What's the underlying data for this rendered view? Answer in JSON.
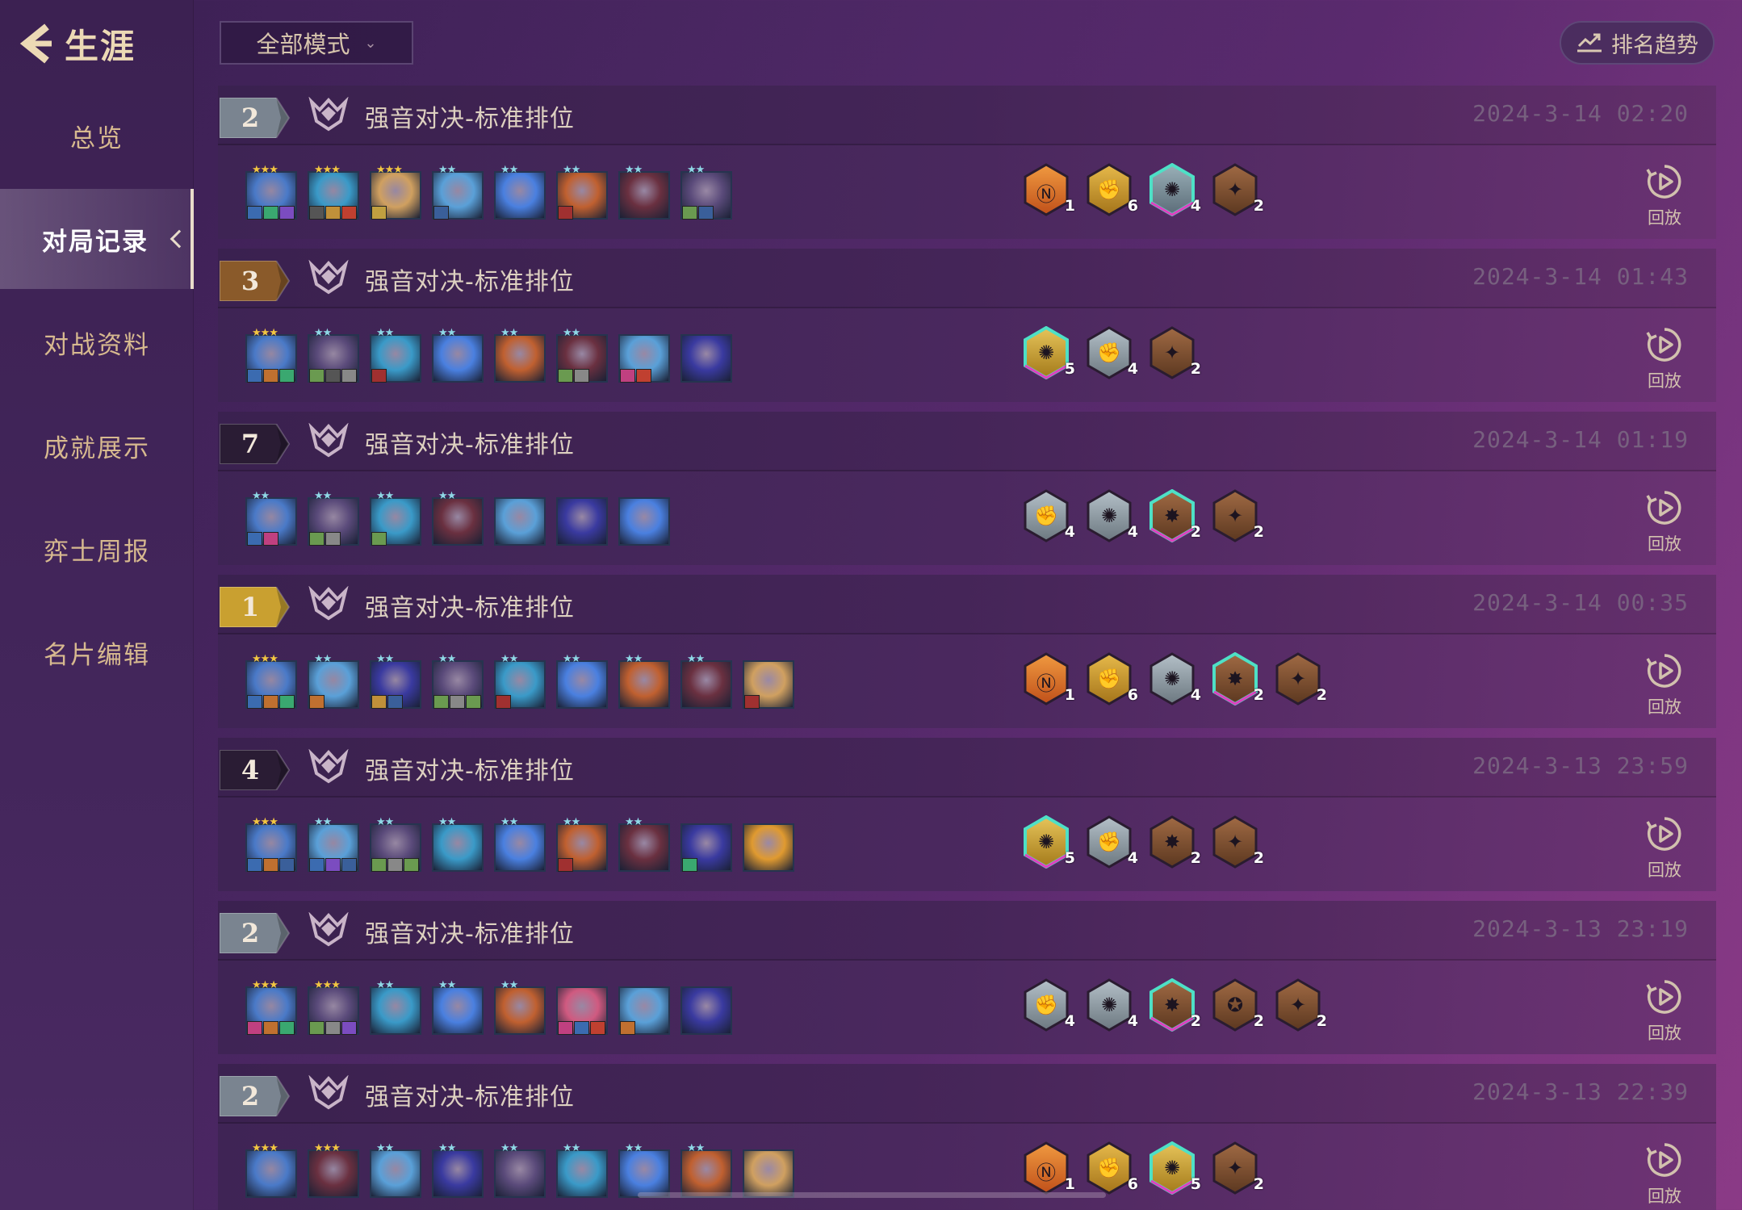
{
  "sidebar": {
    "back_icon": "chevron-left-icon",
    "title": "生涯",
    "items": [
      {
        "label": "总览",
        "active": false
      },
      {
        "label": "对局记录",
        "active": true
      },
      {
        "label": "对战资料",
        "active": false
      },
      {
        "label": "成就展示",
        "active": false
      },
      {
        "label": "弈士周报",
        "active": false
      },
      {
        "label": "名片编辑",
        "active": false
      }
    ]
  },
  "toolbar": {
    "mode_filter": "全部模式",
    "trend_label": "排名趋势",
    "trend_icon": "trend-chart-icon"
  },
  "colors": {
    "gold": "#d9a428",
    "silver": "#9aa7b2",
    "bronze": "#8a5a38",
    "prismatic": "#4ee0c6",
    "orange": "#e8792a"
  },
  "matches": [
    {
      "rank": "2",
      "rank_tier": "silver",
      "mode": "强音对决-标准排位",
      "time": "2024-3-14 02:20",
      "units": [
        {
          "stars": "★★★",
          "star_color": "gold",
          "tone": "#4a7ac8",
          "items": [
            "#3b6bb0",
            "#3aa870",
            "#7b4cc0"
          ]
        },
        {
          "stars": "★★★",
          "star_color": "gold",
          "tone": "#3a9ac8",
          "items": [
            "#555",
            "#c0903a",
            "#c04030"
          ]
        },
        {
          "stars": "★★★",
          "star_color": "gold",
          "tone": "#d0a060",
          "items": [
            "#c0a040"
          ]
        },
        {
          "stars": "★★",
          "star_color": "cyan",
          "tone": "#5aa0d8",
          "items": [
            "#3a5f9a"
          ]
        },
        {
          "stars": "★★",
          "star_color": "cyan",
          "tone": "#4a80e0",
          "items": []
        },
        {
          "stars": "★★",
          "star_color": "cyan",
          "tone": "#c06030",
          "items": [
            "#a03030"
          ]
        },
        {
          "stars": "★★",
          "star_color": "cyan",
          "tone": "#6a3040",
          "items": []
        },
        {
          "stars": "★★",
          "star_color": "cyan",
          "tone": "#5a4a7a",
          "items": [
            "#6a9a50",
            "#3a5f9a"
          ]
        }
      ],
      "traits": [
        {
          "icon": "headliner-icon",
          "tier": "orange",
          "glyph": "Ⓝ",
          "count": "1"
        },
        {
          "icon": "punk-fist-icon",
          "tier": "gold",
          "glyph": "✊",
          "count": "6"
        },
        {
          "icon": "edm-star-icon",
          "tier": "prismatic",
          "glyph": "✺",
          "count": "4"
        },
        {
          "icon": "dazzler-icon",
          "tier": "bronze",
          "glyph": "✦",
          "count": "2"
        }
      ],
      "replay": "回放"
    },
    {
      "rank": "3",
      "rank_tier": "bronze",
      "mode": "强音对决-标准排位",
      "time": "2024-3-14 01:43",
      "units": [
        {
          "stars": "★★★",
          "star_color": "gold",
          "tone": "#4a7ac8",
          "items": [
            "#3b6bb0",
            "#c07030",
            "#3aa870"
          ]
        },
        {
          "stars": "★★",
          "star_color": "cyan",
          "tone": "#5a4a7a",
          "items": [
            "#6a9a50",
            "#555",
            "#888"
          ]
        },
        {
          "stars": "★★",
          "star_color": "cyan",
          "tone": "#3a9ac8",
          "items": [
            "#a03030"
          ]
        },
        {
          "stars": "★★",
          "star_color": "cyan",
          "tone": "#4a80e0",
          "items": []
        },
        {
          "stars": "★★",
          "star_color": "cyan",
          "tone": "#c06030",
          "items": []
        },
        {
          "stars": "★★",
          "star_color": "cyan",
          "tone": "#6a3040",
          "items": [
            "#6a9a50",
            "#888"
          ]
        },
        {
          "stars": "",
          "star_color": "none",
          "tone": "#5aa0d8",
          "items": [
            "#c04080",
            "#c04030"
          ]
        },
        {
          "stars": "",
          "star_color": "none",
          "tone": "#3a3aa0",
          "items": []
        }
      ],
      "traits": [
        {
          "icon": "edm-star-icon",
          "tier": "prismatic-gold",
          "glyph": "✺",
          "count": "5"
        },
        {
          "icon": "punk-fist-icon",
          "tier": "silver",
          "glyph": "✊",
          "count": "4"
        },
        {
          "icon": "dazzler-icon",
          "tier": "bronze",
          "glyph": "✦",
          "count": "2"
        }
      ],
      "replay": "回放"
    },
    {
      "rank": "7",
      "rank_tier": "dark",
      "mode": "强音对决-标准排位",
      "time": "2024-3-14 01:19",
      "units": [
        {
          "stars": "★★",
          "star_color": "cyan",
          "tone": "#4a7ac8",
          "items": [
            "#3b6bb0",
            "#c04080"
          ]
        },
        {
          "stars": "★★",
          "star_color": "cyan",
          "tone": "#5a4a7a",
          "items": [
            "#6a9a50",
            "#888"
          ]
        },
        {
          "stars": "★★",
          "star_color": "cyan",
          "tone": "#3a9ac8",
          "items": [
            "#6a9a50"
          ]
        },
        {
          "stars": "★★",
          "star_color": "cyan",
          "tone": "#6a3040",
          "items": []
        },
        {
          "stars": "",
          "star_color": "none",
          "tone": "#5aa0d8",
          "items": []
        },
        {
          "stars": "",
          "star_color": "none",
          "tone": "#3a3aa0",
          "items": []
        },
        {
          "stars": "",
          "star_color": "none",
          "tone": "#4a80e0",
          "items": []
        }
      ],
      "traits": [
        {
          "icon": "punk-fist-icon",
          "tier": "silver",
          "glyph": "✊",
          "count": "4"
        },
        {
          "icon": "edm-star-icon",
          "tier": "silver",
          "glyph": "✺",
          "count": "4"
        },
        {
          "icon": "burst-icon",
          "tier": "prismatic-bronze",
          "glyph": "✸",
          "count": "2"
        },
        {
          "icon": "dazzler-icon",
          "tier": "bronze",
          "glyph": "✦",
          "count": "2"
        }
      ],
      "replay": "回放"
    },
    {
      "rank": "1",
      "rank_tier": "gold",
      "mode": "强音对决-标准排位",
      "time": "2024-3-14 00:35",
      "units": [
        {
          "stars": "★★★",
          "star_color": "gold",
          "tone": "#4a7ac8",
          "items": [
            "#3b6bb0",
            "#c07030",
            "#3aa870"
          ]
        },
        {
          "stars": "★★",
          "star_color": "cyan",
          "tone": "#5aa0d8",
          "items": [
            "#c07030"
          ]
        },
        {
          "stars": "★★",
          "star_color": "cyan",
          "tone": "#3a3aa0",
          "items": [
            "#c0903a",
            "#3a5f9a"
          ]
        },
        {
          "stars": "★★",
          "star_color": "cyan",
          "tone": "#5a4a7a",
          "items": [
            "#6a9a50",
            "#888",
            "#6a9a50"
          ]
        },
        {
          "stars": "★★",
          "star_color": "cyan",
          "tone": "#3a9ac8",
          "items": [
            "#a03030"
          ]
        },
        {
          "stars": "★★",
          "star_color": "cyan",
          "tone": "#4a80e0",
          "items": []
        },
        {
          "stars": "★★",
          "star_color": "cyan",
          "tone": "#c06030",
          "items": []
        },
        {
          "stars": "★★",
          "star_color": "cyan",
          "tone": "#6a3040",
          "items": []
        },
        {
          "stars": "",
          "star_color": "none",
          "tone": "#d0a060",
          "items": [
            "#a03030"
          ]
        }
      ],
      "traits": [
        {
          "icon": "headliner-icon",
          "tier": "orange",
          "glyph": "Ⓝ",
          "count": "1"
        },
        {
          "icon": "punk-fist-icon",
          "tier": "gold",
          "glyph": "✊",
          "count": "6"
        },
        {
          "icon": "edm-star-icon",
          "tier": "silver",
          "glyph": "✺",
          "count": "4"
        },
        {
          "icon": "burst-icon",
          "tier": "prismatic-bronze",
          "glyph": "✸",
          "count": "2"
        },
        {
          "icon": "dazzler-icon",
          "tier": "bronze",
          "glyph": "✦",
          "count": "2"
        }
      ],
      "replay": "回放"
    },
    {
      "rank": "4",
      "rank_tier": "dark",
      "mode": "强音对决-标准排位",
      "time": "2024-3-13 23:59",
      "units": [
        {
          "stars": "★★★",
          "star_color": "gold",
          "tone": "#4a7ac8",
          "items": [
            "#3b6bb0",
            "#c07030",
            "#3a5f9a"
          ]
        },
        {
          "stars": "★★",
          "star_color": "cyan",
          "tone": "#5aa0d8",
          "items": [
            "#3b6bb0",
            "#7b4cc0",
            "#3a5f9a"
          ]
        },
        {
          "stars": "★★",
          "star_color": "cyan",
          "tone": "#5a4a7a",
          "items": [
            "#6a9a50",
            "#888",
            "#6a9a50"
          ]
        },
        {
          "stars": "★★",
          "star_color": "cyan",
          "tone": "#3a9ac8",
          "items": []
        },
        {
          "stars": "★★",
          "star_color": "cyan",
          "tone": "#4a80e0",
          "items": []
        },
        {
          "stars": "★★",
          "star_color": "cyan",
          "tone": "#c06030",
          "items": [
            "#a03030"
          ]
        },
        {
          "stars": "★★",
          "star_color": "cyan",
          "tone": "#6a3040",
          "items": []
        },
        {
          "stars": "",
          "star_color": "none",
          "tone": "#3a3aa0",
          "items": [
            "#3aa870"
          ]
        },
        {
          "stars": "",
          "star_color": "none",
          "tone": "#e09a30",
          "items": []
        }
      ],
      "traits": [
        {
          "icon": "edm-star-icon",
          "tier": "prismatic-gold",
          "glyph": "✺",
          "count": "5"
        },
        {
          "icon": "punk-fist-icon",
          "tier": "silver",
          "glyph": "✊",
          "count": "4"
        },
        {
          "icon": "burst-icon",
          "tier": "bronze",
          "glyph": "✸",
          "count": "2"
        },
        {
          "icon": "dazzler-icon",
          "tier": "bronze",
          "glyph": "✦",
          "count": "2"
        }
      ],
      "replay": "回放"
    },
    {
      "rank": "2",
      "rank_tier": "silver",
      "mode": "强音对决-标准排位",
      "time": "2024-3-13 23:19",
      "units": [
        {
          "stars": "★★★",
          "star_color": "gold",
          "tone": "#4a7ac8",
          "items": [
            "#c04080",
            "#c07030",
            "#3aa870"
          ]
        },
        {
          "stars": "★★★",
          "star_color": "gold",
          "tone": "#5a4a7a",
          "items": [
            "#6a9a50",
            "#888",
            "#7b4cc0"
          ]
        },
        {
          "stars": "★★",
          "star_color": "cyan",
          "tone": "#3a9ac8",
          "items": []
        },
        {
          "stars": "★★",
          "star_color": "cyan",
          "tone": "#4a80e0",
          "items": []
        },
        {
          "stars": "★★",
          "star_color": "cyan",
          "tone": "#c06030",
          "items": []
        },
        {
          "stars": "",
          "star_color": "none",
          "tone": "#d05a80",
          "items": [
            "#c04080",
            "#3b6bb0",
            "#c04030"
          ]
        },
        {
          "stars": "",
          "star_color": "none",
          "tone": "#5aa0d8",
          "items": [
            "#c07030"
          ]
        },
        {
          "stars": "",
          "star_color": "none",
          "tone": "#3a3aa0",
          "items": []
        }
      ],
      "traits": [
        {
          "icon": "punk-fist-icon",
          "tier": "silver",
          "glyph": "✊",
          "count": "4"
        },
        {
          "icon": "edm-star-icon",
          "tier": "silver",
          "glyph": "✺",
          "count": "4"
        },
        {
          "icon": "burst-icon",
          "tier": "prismatic-bronze",
          "glyph": "✸",
          "count": "2"
        },
        {
          "icon": "rapidfire-icon",
          "tier": "bronze",
          "glyph": "✪",
          "count": "2"
        },
        {
          "icon": "dazzler-icon",
          "tier": "bronze",
          "glyph": "✦",
          "count": "2"
        }
      ],
      "replay": "回放"
    },
    {
      "rank": "2",
      "rank_tier": "silver",
      "mode": "强音对决-标准排位",
      "time": "2024-3-13 22:39",
      "units": [
        {
          "stars": "★★★",
          "star_color": "gold",
          "tone": "#4a7ac8",
          "items": []
        },
        {
          "stars": "★★★",
          "star_color": "gold",
          "tone": "#6a3040",
          "items": []
        },
        {
          "stars": "★★",
          "star_color": "cyan",
          "tone": "#5aa0d8",
          "items": []
        },
        {
          "stars": "★★",
          "star_color": "cyan",
          "tone": "#3a3aa0",
          "items": []
        },
        {
          "stars": "★★",
          "star_color": "cyan",
          "tone": "#5a4a7a",
          "items": []
        },
        {
          "stars": "★★",
          "star_color": "cyan",
          "tone": "#3a9ac8",
          "items": []
        },
        {
          "stars": "★★",
          "star_color": "cyan",
          "tone": "#4a80e0",
          "items": []
        },
        {
          "stars": "★★",
          "star_color": "cyan",
          "tone": "#c06030",
          "items": []
        },
        {
          "stars": "",
          "star_color": "none",
          "tone": "#d0a060",
          "items": []
        }
      ],
      "traits": [
        {
          "icon": "headliner-icon",
          "tier": "orange",
          "glyph": "Ⓝ",
          "count": "1"
        },
        {
          "icon": "punk-fist-icon",
          "tier": "gold",
          "glyph": "✊",
          "count": "6"
        },
        {
          "icon": "edm-star-icon",
          "tier": "prismatic-gold",
          "glyph": "✺",
          "count": "5"
        },
        {
          "icon": "dazzler-icon",
          "tier": "bronze",
          "glyph": "✦",
          "count": "2"
        }
      ],
      "replay": "回放"
    }
  ]
}
